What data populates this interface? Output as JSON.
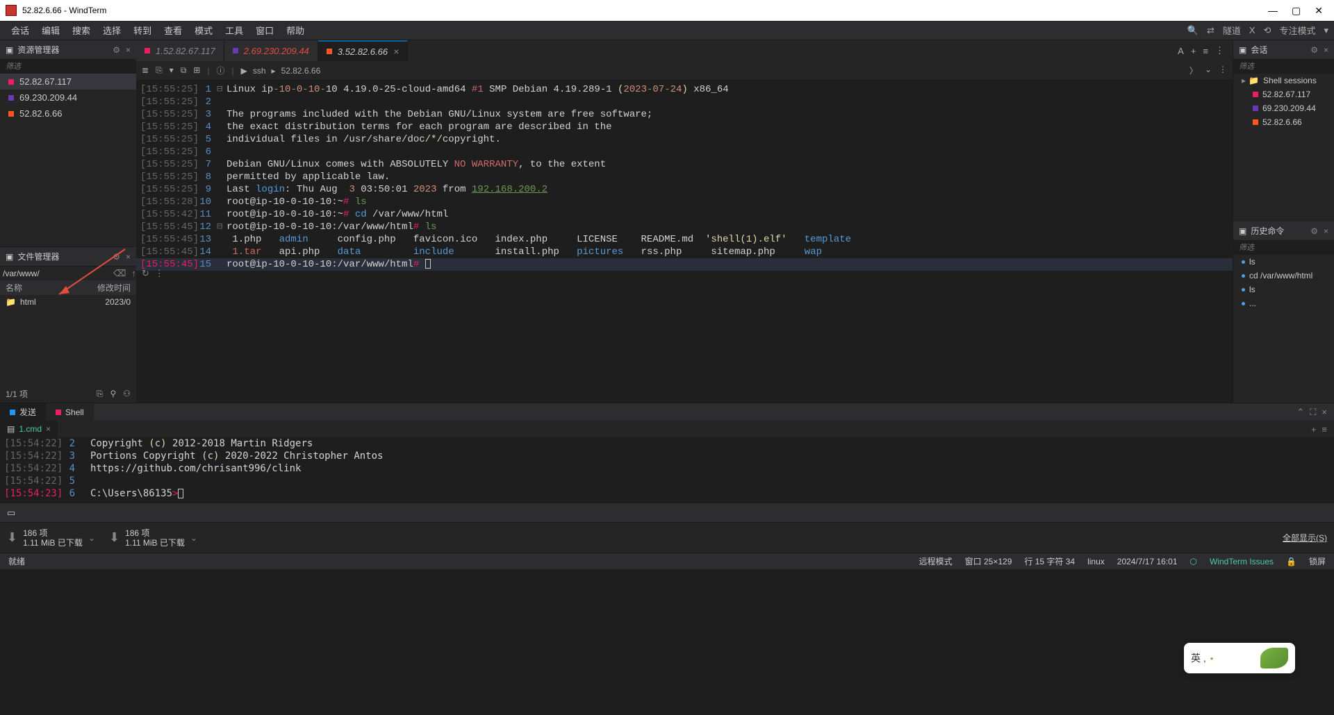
{
  "window": {
    "title": "52.82.6.66 - WindTerm"
  },
  "menu": {
    "items": [
      "会话",
      "编辑",
      "搜索",
      "选择",
      "转到",
      "查看",
      "模式",
      "工具",
      "窗口",
      "帮助"
    ],
    "right": {
      "tunnel": "隧道",
      "focus": "专注模式"
    }
  },
  "explorer": {
    "title": "资源管理器",
    "filter": "筛选",
    "items": [
      {
        "label": "52.82.67.117",
        "color": "dot-pink"
      },
      {
        "label": "69.230.209.44",
        "color": "dot-purple"
      },
      {
        "label": "52.82.6.66",
        "color": "dot-orange"
      }
    ]
  },
  "filemgr": {
    "title": "文件管理器",
    "path": "/var/www/",
    "col_name": "名称",
    "col_date": "修改时间",
    "items": [
      {
        "name": "html",
        "date": "2023/0"
      }
    ],
    "status": "1/1 项"
  },
  "tabs": [
    {
      "prefix": "1.",
      "label": "52.82.67.117",
      "color": "dot-pink",
      "strike": true
    },
    {
      "prefix": "2.",
      "label": "69.230.209.44",
      "color": "dot-purple",
      "red": true
    },
    {
      "prefix": "3.",
      "label": "52.82.6.66",
      "color": "dot-orange",
      "active": true
    }
  ],
  "breadcrumb": {
    "proto": "ssh",
    "host": "52.82.6.66"
  },
  "terminal_lines": [
    {
      "t": "[15:55:25]",
      "n": "1",
      "fold": "⊟",
      "html": "<span class='c-white'>Linux ip</span><span class='c-gray'>-</span><span class='c-orange'>10</span><span class='c-gray'>-</span><span class='c-orange'>0</span><span class='c-gray'>-</span><span class='c-orange'>10</span><span class='c-gray'>-</span><span class='c-white'>10 4.19.0-25-cloud-amd64 </span><span class='c-red'>#1</span><span class='c-white'> SMP Debian 4.19.289-1 </span><span class='c-yellow'>(</span><span class='c-orange'>2023</span><span class='c-gray'>-</span><span class='c-orange'>07</span><span class='c-gray'>-</span><span class='c-orange'>24</span><span class='c-yellow'>)</span><span class='c-white'> x86_64</span>"
    },
    {
      "t": "[15:55:25]",
      "n": "2",
      "html": ""
    },
    {
      "t": "[15:55:25]",
      "n": "3",
      "html": "<span class='c-white'>The programs included with the Debian GNU/Linux system are free software;</span>"
    },
    {
      "t": "[15:55:25]",
      "n": "4",
      "html": "<span class='c-white'>the exact distribution terms for each program are described in the</span>"
    },
    {
      "t": "[15:55:25]",
      "n": "5",
      "html": "<span class='c-white'>individual files in /usr/share/doc</span><span class='c-yellow'>/*/</span><span class='c-white'>copyright.</span>"
    },
    {
      "t": "[15:55:25]",
      "n": "6",
      "html": ""
    },
    {
      "t": "[15:55:25]",
      "n": "7",
      "html": "<span class='c-white'>Debian GNU/Linux comes with ABSOLUTELY </span><span class='c-red'>NO WARRANTY</span><span class='c-white'>, to the extent</span>"
    },
    {
      "t": "[15:55:25]",
      "n": "8",
      "html": "<span class='c-white'>permitted by applicable law.</span>"
    },
    {
      "t": "[15:55:25]",
      "n": "9",
      "html": "<span class='c-white'>Last </span><span class='c-blue'>login</span><span class='c-white'>: Thu Aug  </span><span class='c-orange'>3</span><span class='c-white'> 03:50:01 </span><span class='c-orange'>2023</span><span class='c-white'> from </span><span class='c-link'>192.168.200.2</span>"
    },
    {
      "t": "[15:55:28]",
      "n": "10",
      "html": "<span class='c-white'>root@ip-10-0-10-10:~</span><span class='c-prompt'>#</span><span class='c-white'> </span><span class='c-green'>ls</span>"
    },
    {
      "t": "[15:55:42]",
      "n": "11",
      "html": "<span class='c-white'>root@ip-10-0-10-10:~</span><span class='c-prompt'>#</span><span class='c-white'> </span><span class='c-blue'>cd</span><span class='c-white'> /var/www/html</span>"
    },
    {
      "t": "[15:55:45]",
      "n": "12",
      "fold": "⊟",
      "html": "<span class='c-white'>root@ip-10-0-10-10:/var/www/html</span><span class='c-prompt'>#</span><span class='c-white'> </span><span class='c-green'>ls</span>"
    },
    {
      "t": "[15:55:45]",
      "n": "13",
      "html": "<span class='c-white'> 1.php   </span><span class='c-blue'>admin</span><span class='c-white'>     config.php   favicon.ico   index.php     LICENSE    README.md  </span><span class='c-yellow'>'shell(1).elf'</span><span class='c-white'>   </span><span class='c-blue'>template</span>"
    },
    {
      "t": "[15:55:45]",
      "n": "14",
      "html": "<span class='c-white'> </span><span class='c-red'>1.tar</span><span class='c-white'>   api.php   </span><span class='c-blue'>data</span><span class='c-white'>         </span><span class='c-blue'>include</span><span class='c-white'>       install.php   </span><span class='c-blue'>pictures</span><span class='c-white'>   rss.php     sitemap.php     </span><span class='c-blue'>wap</span>"
    },
    {
      "t": "[15:55:45]",
      "n": "15",
      "current": true,
      "hl": true,
      "html": "<span class='c-white'>root@ip-10-0-10-10:/var/www/html</span><span class='c-prompt'>#</span><span class='c-white'> </span><span class='cursor-box'></span>"
    }
  ],
  "sessions": {
    "title": "会话",
    "filter": "筛选",
    "root": "Shell sessions",
    "items": [
      {
        "label": "52.82.67.117",
        "color": "dot-pink"
      },
      {
        "label": "69.230.209.44",
        "color": "dot-purple"
      },
      {
        "label": "52.82.6.66",
        "color": "dot-orange"
      }
    ]
  },
  "history": {
    "title": "历史命令",
    "filter": "筛选",
    "items": [
      "ls",
      "cd /var/www/html",
      "ls",
      "..."
    ]
  },
  "bottom_tabs": {
    "send": "发送",
    "shell": "Shell"
  },
  "shell_file": "1.cmd",
  "shell_lines": [
    {
      "t": "[15:54:22]",
      "n": "2",
      "html": "<span class='c-white'>Copyright </span><span class='c-yellow'>(</span><span class='c-white'>c</span><span class='c-yellow'>)</span><span class='c-white'> 2012-2018 Martin Ridgers</span>"
    },
    {
      "t": "[15:54:22]",
      "n": "3",
      "html": "<span class='c-white'>Portions Copyright </span><span class='c-yellow'>(</span><span class='c-white'>c</span><span class='c-yellow'>)</span><span class='c-white'> 2020-2022 Christopher Antos</span>"
    },
    {
      "t": "[15:54:22]",
      "n": "4",
      "html": "<span class='c-white'>https://github.com/chrisant996/clink</span>"
    },
    {
      "t": "[15:54:22]",
      "n": "5",
      "html": ""
    },
    {
      "t": "[15:54:23]",
      "n": "6",
      "current": true,
      "html": "<span class='c-white'>C:\\Users\\86135</span><span class='c-prompt'>></span><span class='cursor-box'></span>"
    }
  ],
  "downloads": {
    "items": [
      {
        "count": "186 项",
        "size": "1.11 MiB 已下载"
      },
      {
        "count": "186 项",
        "size": "1.11 MiB 已下载"
      }
    ],
    "show_all": "全部显示(S)"
  },
  "status": {
    "ready": "就绪",
    "mode": "远程模式",
    "window": "窗口 25×129",
    "cursor": "行 15 字符 34",
    "os": "linux",
    "datetime": "2024/7/17 16:01",
    "issues": "WindTerm Issues",
    "lock": "锁屏"
  },
  "ime": "英 ,"
}
